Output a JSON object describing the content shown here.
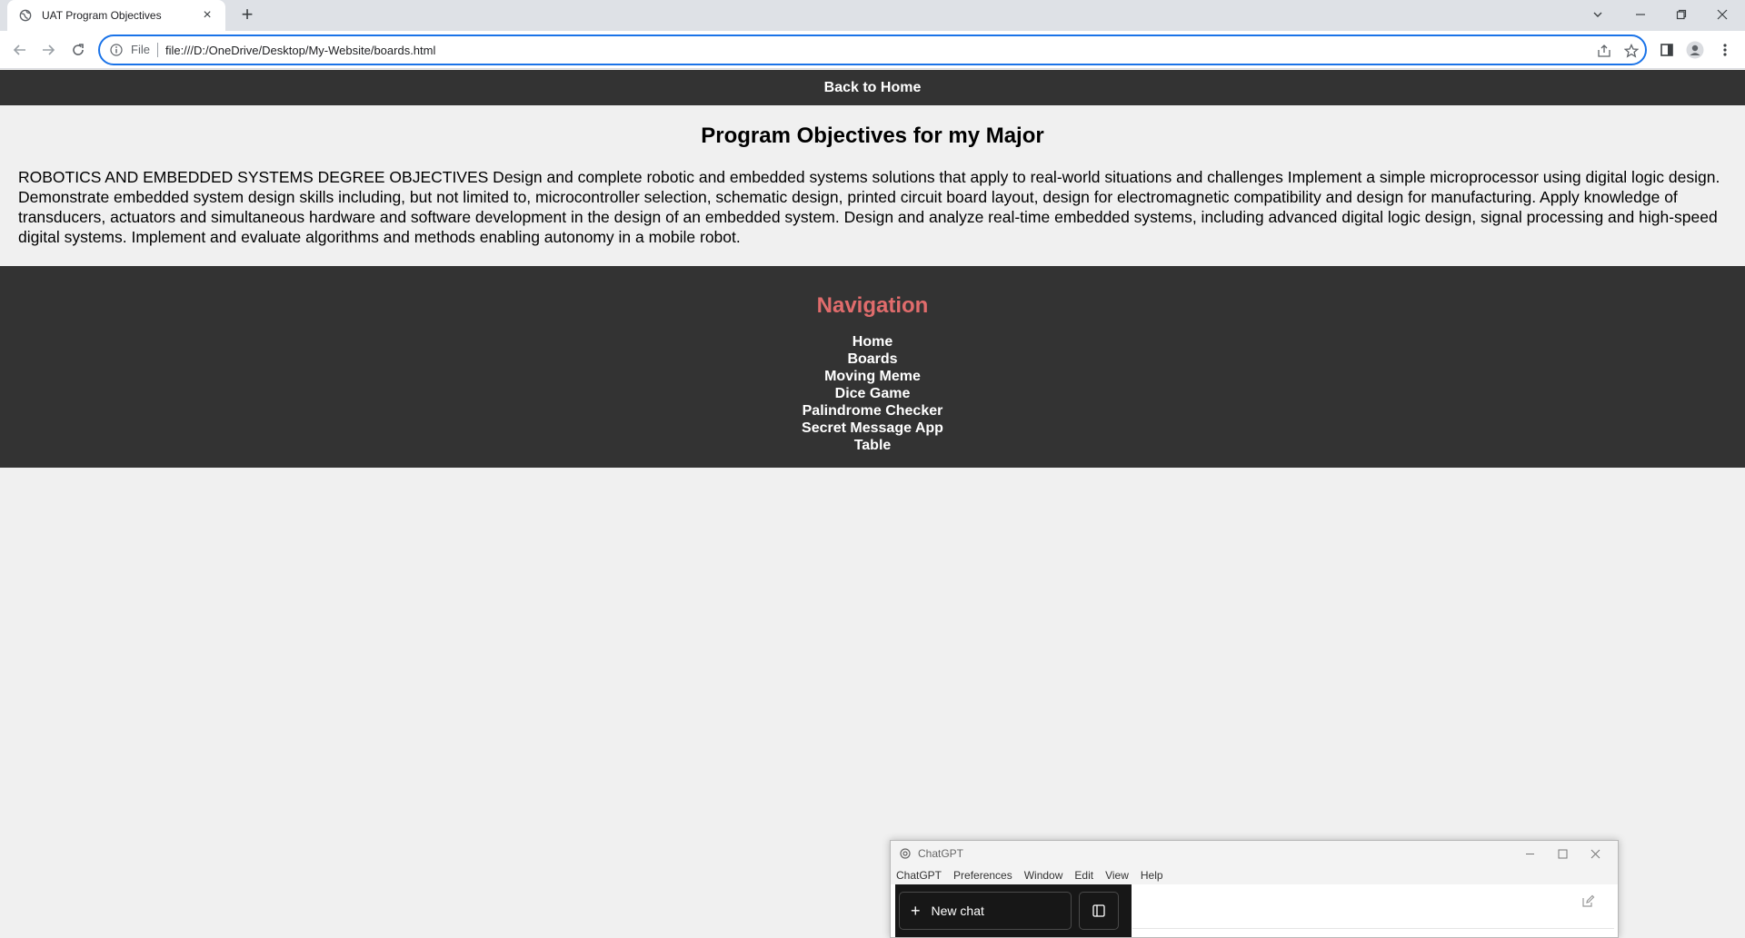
{
  "browser": {
    "tab_title": "UAT Program Objectives",
    "new_tab_symbol": "+",
    "url_scheme_label": "File",
    "url": "file:///D:/OneDrive/Desktop/My-Website/boards.html"
  },
  "page": {
    "top_link": "Back to Home",
    "title": "Program Objectives for my Major",
    "objectives": "ROBOTICS AND EMBEDDED SYSTEMS DEGREE OBJECTIVES Design and complete robotic and embedded systems solutions that apply to real-world situations and challenges Implement a simple microprocessor using digital logic design. Demonstrate embedded system design skills including, but not limited to, microcontroller selection, schematic design, printed circuit board layout, design for electromagnetic compatibility and design for manufacturing. Apply knowledge of transducers, actuators and simultaneous hardware and software development in the design of an embedded system. Design and analyze real-time embedded systems, including advanced digital logic design, signal processing and high-speed digital systems. Implement and evaluate algorithms and methods enabling autonomy in a mobile robot.",
    "footer": {
      "heading": "Navigation",
      "links": [
        "Home",
        "Boards",
        "Moving Meme",
        "Dice Game",
        "Palindrome Checker",
        "Secret Message App",
        "Table"
      ]
    }
  },
  "chatgpt_window": {
    "title": "ChatGPT",
    "menu": [
      "ChatGPT",
      "Preferences",
      "Window",
      "Edit",
      "View",
      "Help"
    ],
    "new_chat_label": "New chat"
  },
  "colors": {
    "nav_bar": "#333333",
    "footer_heading": "#e06c6c",
    "page_background": "#f0f0f0"
  }
}
